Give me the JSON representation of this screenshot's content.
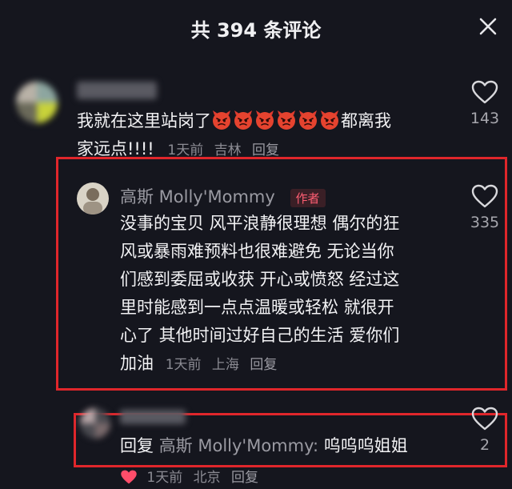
{
  "header": {
    "title": "共 394 条评论"
  },
  "comments": [
    {
      "username": "",
      "text_part1": "我就在这里站岗了",
      "text_part2": "都离我",
      "text_line2": "家远点!!!!",
      "emoji_count": 6,
      "time": "1天前",
      "location": "吉林",
      "reply_label": "回复",
      "likes": "143"
    },
    {
      "username": "高斯 Molly'Mommy",
      "badge": "作者",
      "lines": [
        "没事的宝贝 风平浪静很理想 偶尔的狂",
        "风或暴雨难预料也很难避免 无论当你",
        "们感到委屈或收获 开心或愤怒 经过这",
        "里时能感到一点点温暖或轻松 就很开",
        "心了 其他时间过好自己的生活 爱你们",
        "加油"
      ],
      "time": "1天前",
      "location": "上海",
      "reply_label": "回复",
      "likes": "335"
    },
    {
      "username": "",
      "reply_prefix": "回复",
      "reply_to": "高斯 Molly'Mommy:",
      "text": "呜呜呜姐姐",
      "time": "1天前",
      "location": "北京",
      "reply_label": "回复",
      "likes": "2"
    }
  ],
  "colors": {
    "background": "#15161e",
    "highlight": "#e0262b",
    "badge_text": "#ff5e73",
    "heart": "#ff4d6a"
  },
  "icons": {
    "close": "close-icon",
    "like": "heart-outline-icon",
    "emoji": "angry-devil-emoji",
    "liked": "heart-filled-icon"
  }
}
